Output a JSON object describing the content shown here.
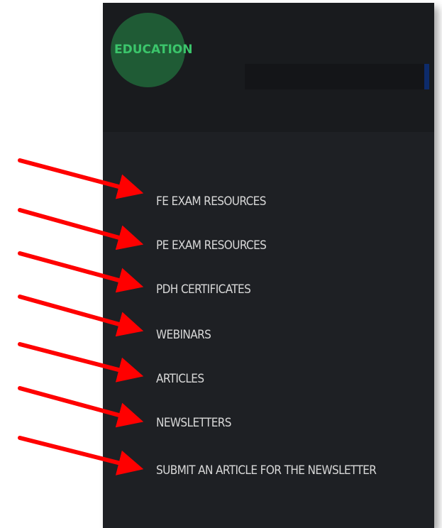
{
  "header": {
    "section_title": "EDUCATION"
  },
  "menu": {
    "items": [
      {
        "label": "FE EXAM RESOURCES"
      },
      {
        "label": "PE EXAM RESOURCES"
      },
      {
        "label": "PDH CERTIFICATES"
      },
      {
        "label": "WEBINARS"
      },
      {
        "label": "ARTICLES"
      },
      {
        "label": "NEWSLETTERS"
      },
      {
        "label": "SUBMIT AN ARTICLE FOR THE NEWSLETTER"
      }
    ]
  },
  "colors": {
    "panel_background": "#1e2024",
    "header_background": "#191b1e",
    "section_title": "#3bc56b",
    "logo_circle": "#1f5b35",
    "menu_text": "#d8d8d8",
    "arrow": "#ff0000"
  },
  "icons": {
    "annotation": "red-arrow-icon"
  }
}
